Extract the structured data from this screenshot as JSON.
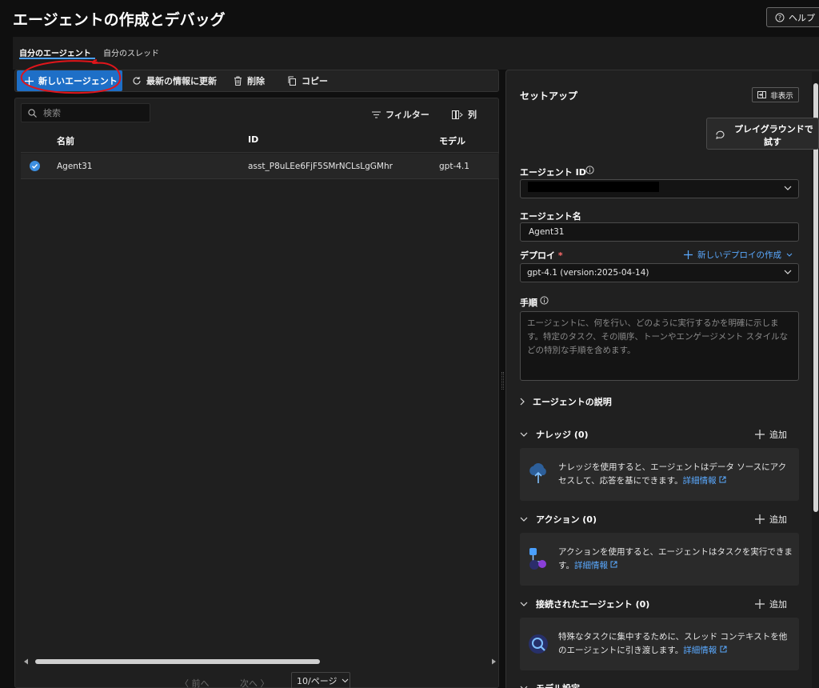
{
  "header": {
    "title": "エージェントの作成とデバッグ",
    "help_label": "ヘルプ"
  },
  "tabs": [
    {
      "label": "自分のエージェント",
      "active": true
    },
    {
      "label": "自分のスレッド",
      "active": false
    }
  ],
  "toolbar": {
    "new_agent": "新しいエージェント",
    "refresh": "最新の情報に更新",
    "delete": "削除",
    "copy": "コピー"
  },
  "list": {
    "search_placeholder": "検索",
    "filter_label": "フィルター",
    "columns_label": "列",
    "headers": {
      "name": "名前",
      "id": "ID",
      "model": "モデル"
    },
    "rows": [
      {
        "name": "Agent31",
        "id": "asst_P8uLEe6FjF5SMrNCLsLgGMhr",
        "model": "gpt-4.1",
        "selected": true
      }
    ],
    "pager": {
      "prev": "前へ",
      "next": "次へ",
      "page_size": "10/ページ"
    }
  },
  "setup": {
    "title": "セットアップ",
    "hide_label": "非表示",
    "playground_line1": "プレイグラウンドで",
    "playground_line2": "試す",
    "agent_id_label": "エージェント ID",
    "agent_name_label": "エージェント名",
    "agent_name_value": "Agent31",
    "deploy_label": "デプロイ",
    "required_mark": "*",
    "new_deploy_label": "新しいデプロイの作成",
    "deploy_value": "gpt-4.1 (version:2025-04-14)",
    "instructions_label": "手順",
    "instructions_placeholder": "エージェントに、何を行い、どのように実行するかを明確に示します。特定のタスク、その順序、トーンやエンゲージメント スタイルなどの特別な手順を含めます。",
    "description_section": "エージェントの説明",
    "knowledge_section": "ナレッジ (0)",
    "knowledge_text": "ナレッジを使用すると、エージェントはデータ ソースにアクセスして、応答を基にできます。",
    "actions_section": "アクション (0)",
    "actions_text": "アクションを使用すると、エージェントはタスクを実行できます。",
    "connected_section": "接続されたエージェント (0)",
    "connected_text": "特殊なタスクに集中するために、スレッド コンテキストを他のエージェントに引き渡します。",
    "more_info": "詳細情報",
    "add_label": "追加",
    "model_settings_section": "モデル設定"
  },
  "colors": {
    "accent": "#1e6fc7",
    "link": "#5aa9ff",
    "annotation": "#e0151b"
  }
}
